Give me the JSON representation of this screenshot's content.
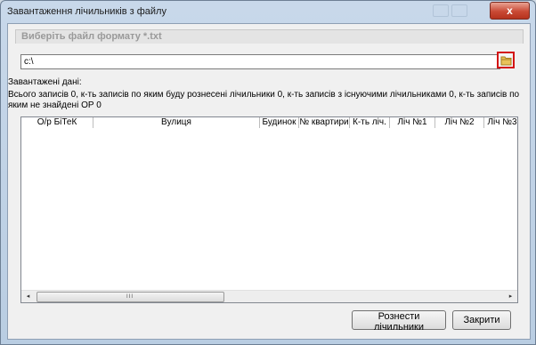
{
  "window": {
    "title": "Завантаження лічильників з файлу",
    "close_glyph": "x"
  },
  "group": {
    "label": "Виберіть файл формату *.txt"
  },
  "path_input": {
    "value": "c:\\"
  },
  "loaded_label": "Завантажені дані:",
  "info": "Всього записів 0, к-ть записів по яким буду рознесені лічильники 0, к-ть записів з існуючими лічильниками 0, к-ть записів по яким не знайдені ОР 0",
  "table": {
    "columns": [
      "О/р БіТеК",
      "Вулиця",
      "Будинок",
      "№ квартири",
      "К-ть ліч.",
      "Ліч №1",
      "Ліч №2",
      "Ліч №3"
    ],
    "rows": []
  },
  "scrollbar": {
    "left_arrow": "◂",
    "right_arrow": "▸",
    "grip": "III"
  },
  "buttons": {
    "distribute": "Рознести лічильники",
    "close": "Закрити"
  },
  "colors": {
    "close_button": "#c94a35",
    "highlight_border": "#d31414",
    "folder_icon": "#e9c25a"
  }
}
